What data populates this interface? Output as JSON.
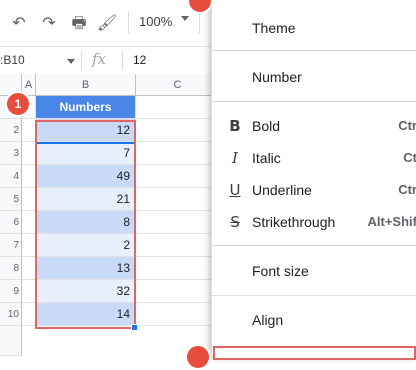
{
  "toolbar": {
    "undo_icon": "undo-icon",
    "redo_icon": "redo-icon",
    "print_icon": "print-icon",
    "paint_format_icon": "paint-format-icon",
    "zoom": "100%"
  },
  "formula_bar": {
    "name_box": ":B10",
    "fx": "fx",
    "value": "12"
  },
  "grid": {
    "columns": [
      "A",
      "B",
      "C"
    ],
    "rows": [
      "1",
      "2",
      "3",
      "4",
      "5",
      "6",
      "7",
      "8",
      "9",
      "10"
    ],
    "header": "Numbers",
    "values": [
      "12",
      "7",
      "49",
      "21",
      "8",
      "2",
      "13",
      "32",
      "14"
    ]
  },
  "badges": {
    "one": "1"
  },
  "menu": {
    "theme": "Theme",
    "number": "Number",
    "bold": "Bold",
    "bold_shortcut": "Ctr",
    "italic": "Italic",
    "italic_shortcut": "Ct",
    "underline": "Underline",
    "underline_shortcut": "Ctr",
    "strikethrough": "Strikethrough",
    "strikethrough_shortcut": "Alt+Shif",
    "font_size": "Font size",
    "align": "Align"
  },
  "colors": {
    "header_blue": "#4a86e8",
    "selection_blue": "#c9daf8",
    "highlight_red": "#e06666",
    "badge_red": "#e74c3c"
  }
}
